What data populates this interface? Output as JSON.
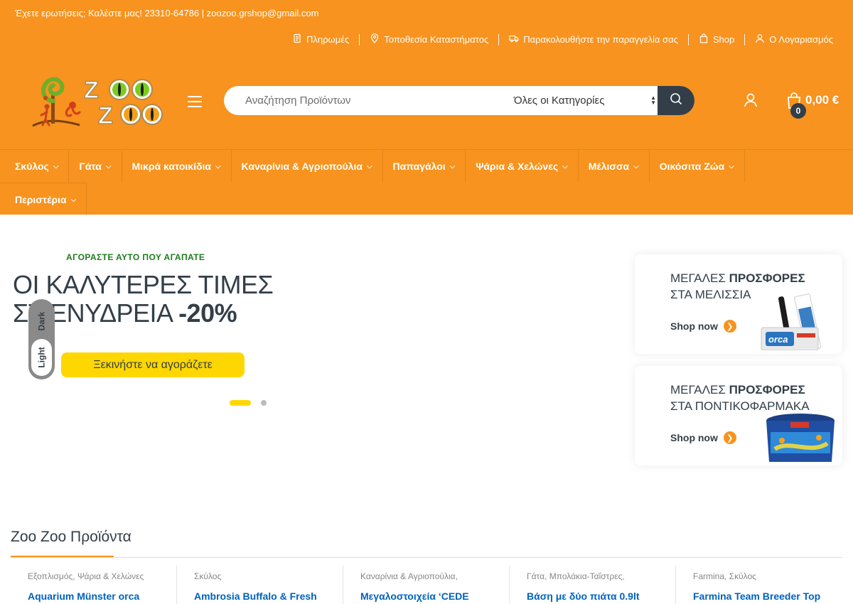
{
  "topbar": {
    "contact": "Έχετε ερωτήσεις; Καλέστε μας! 23310-64786 | zoozoo.grshop@gmail.com",
    "links": [
      {
        "label": "Πληρωμές",
        "icon": "payment-icon"
      },
      {
        "label": "Τοποθεσία Καταστήματος",
        "icon": "map-pin-icon"
      },
      {
        "label": "Παρακολουθήστε την παραγγελία σας",
        "icon": "truck-icon"
      },
      {
        "label": "Shop",
        "icon": "shopping-bag-icon"
      },
      {
        "label": "Ο Λογαριασμός",
        "icon": "user-icon"
      }
    ]
  },
  "header": {
    "logo_text": "ZOO ZOO",
    "search": {
      "placeholder": "Αναζήτηση Προϊόντων",
      "category_selected": "Όλες οι Κατηγορίες"
    },
    "cart": {
      "count": "0",
      "amount": "0,00 €"
    }
  },
  "nav": {
    "items": [
      {
        "label": "Σκύλος"
      },
      {
        "label": "Γάτα"
      },
      {
        "label": "Μικρά κατοικίδια"
      },
      {
        "label": "Καναρίνια & Αγριοπούλια"
      },
      {
        "label": "Παπαγάλοι"
      },
      {
        "label": "Ψάρια & Χελώνες"
      },
      {
        "label": "Μέλισσα"
      },
      {
        "label": "Οικόσιτα Ζώα"
      },
      {
        "label": "Περιστέρια"
      }
    ]
  },
  "hero": {
    "eyebrow": "ΑΓΟΡΑΣΤΕ ΑΥΤΟ ΠΟΥ ΑΓΑΠΑΤΕ",
    "line1": "ΟΙ ΚΑΛΥΤΕΡΕΣ ΤΙΜΕΣ",
    "line2_prefix": "ΣΤ ΕΝΥΔΡΕΙΑ",
    "line2_bold": "-20%",
    "button": "Ξεκινήστε να αγοράζετε",
    "active_slide": 1,
    "slide_count": 2
  },
  "mode_toggle": {
    "dark": "Dark",
    "light": "Light",
    "selected": "Light"
  },
  "promos": [
    {
      "light": "ΜΕΓΑΛΕΣ",
      "bold": "ΠΡΟΣΦΟΡΕΣ",
      "line2": "ΣΤΑ ΜΕΛΙΣΣΙΑ",
      "cta": "Shop now"
    },
    {
      "light": "ΜΕΓΑΛΕΣ",
      "bold": "ΠΡΟΣΦΟΡΕΣ",
      "line2": "ΣΤΑ ΠΟΝΤΙΚΟΦΑΡΜΑΚΑ",
      "cta": "Shop now"
    }
  ],
  "products_section": {
    "title": "Zoo Zoo Προϊόντα",
    "items": [
      {
        "categories": "Εξοπλισμός, Ψάρια & Χελώνες",
        "name": "Aquarium Münster orca"
      },
      {
        "categories": "Σκύλος",
        "name": "Ambrosia Buffalo & Fresh"
      },
      {
        "categories": "Καναρίνια & Αγριοπούλια,",
        "name": "Μεγαλοστοιχεία ‘CEDE"
      },
      {
        "categories": "Γάτα, Μπολάκια-Ταΐστρες,",
        "name": "Βάση με δύο πιάτα 0.9lt"
      },
      {
        "categories": "Farmina, Σκύλος",
        "name": "Farmina Team Breeder Top"
      }
    ]
  },
  "colors": {
    "brand_orange": "#f7931e",
    "dark": "#333e48",
    "accent_yellow": "#fed700",
    "link_blue": "#0062bd",
    "eyebrow_green": "#1e7c1e"
  }
}
